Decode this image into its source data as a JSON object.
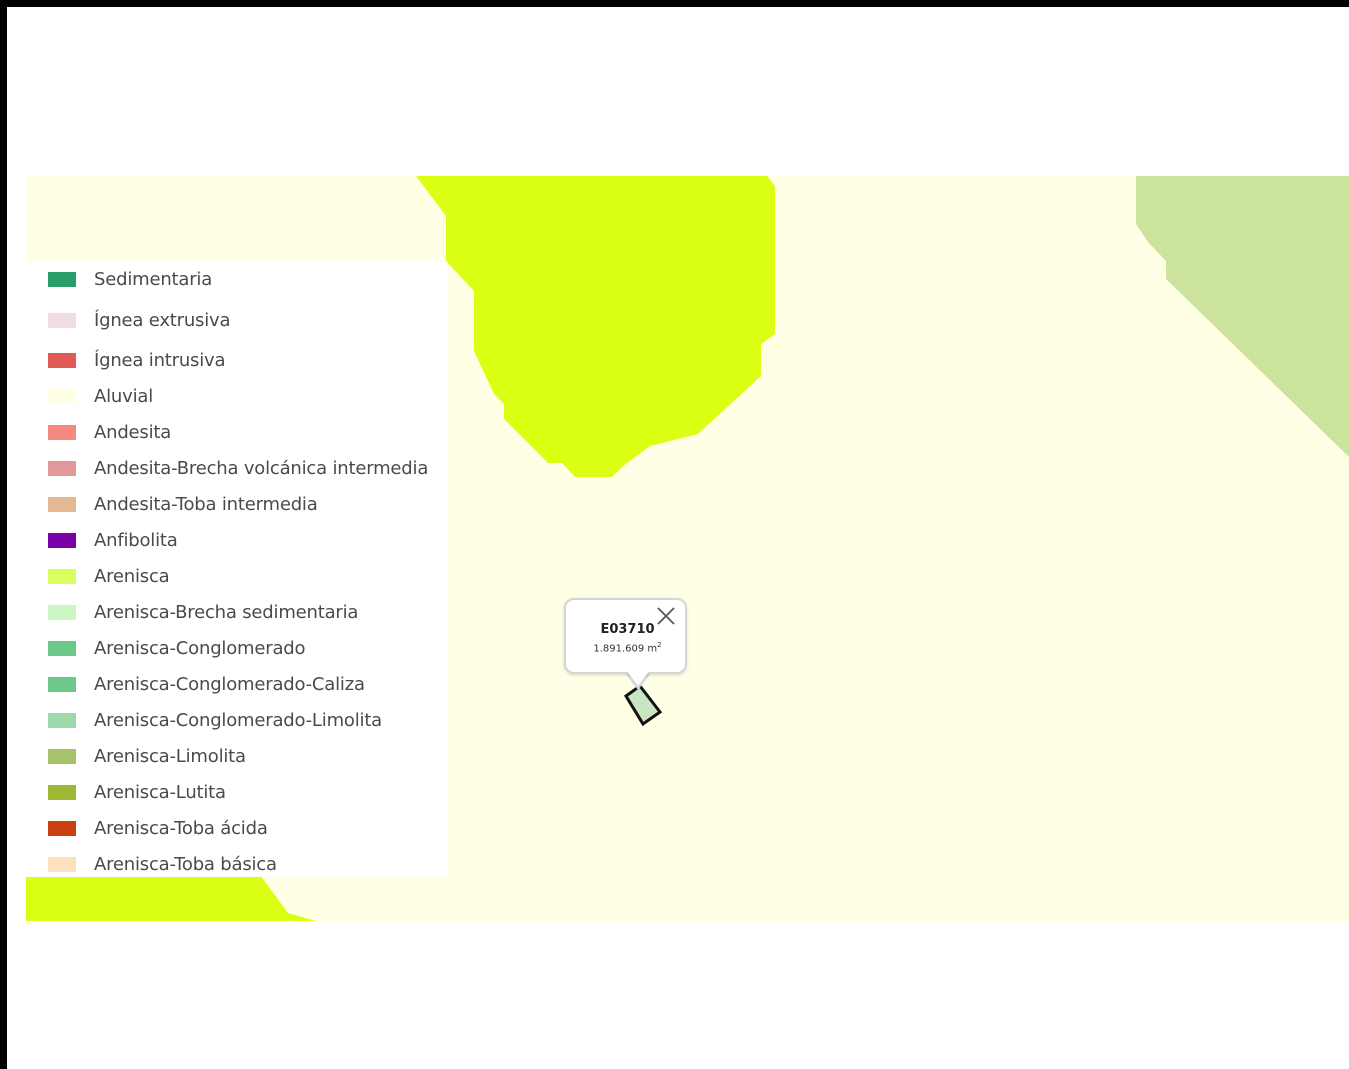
{
  "map": {
    "colors": {
      "background": "#ffffe6",
      "arenisca": "#dbff13",
      "arenisca_limolita": "#cce39b",
      "parcel_fill": "#c8e6c2",
      "parcel_stroke": "#111111"
    }
  },
  "legend": {
    "items": [
      {
        "label": "Sedimentaria",
        "color": "#2a9d6a"
      },
      {
        "label": "Ígnea extrusiva",
        "color": "#f0dde2"
      },
      {
        "label": "Ígnea intrusiva",
        "color": "#e05a56"
      },
      {
        "label": "Aluvial",
        "color": "#ffffe6"
      },
      {
        "label": "Andesita",
        "color": "#f58b80"
      },
      {
        "label": "Andesita-Brecha volcánica intermedia",
        "color": "#e0989a"
      },
      {
        "label": "Andesita-Toba intermedia",
        "color": "#e3b893"
      },
      {
        "label": " Anfibolita",
        "color": "#7a00a8"
      },
      {
        "label": "Arenisca",
        "color": "#d8ff5e"
      },
      {
        "label": "Arenisca-Brecha sedimentaria",
        "color": "#ccf7c4"
      },
      {
        "label": "Arenisca-Conglomerado",
        "color": "#6cc98a"
      },
      {
        "label": "Arenisca-Conglomerado-Caliza",
        "color": "#6cc98a"
      },
      {
        "label": "Arenisca-Conglomerado-Limolita",
        "color": "#9ed9ab"
      },
      {
        "label": "Arenisca-Limolita",
        "color": "#a6c26c"
      },
      {
        "label": "Arenisca-Lutita",
        "color": "#9eb833"
      },
      {
        "label": "Arenisca-Toba ácida",
        "color": "#c8410f"
      },
      {
        "label": "Arenisca-Toba básica",
        "color": "#fde0c0"
      }
    ]
  },
  "popup": {
    "title": "E03710",
    "area_value": "1.891.609 m",
    "area_exponent": "2",
    "close_icon": "close-icon"
  }
}
